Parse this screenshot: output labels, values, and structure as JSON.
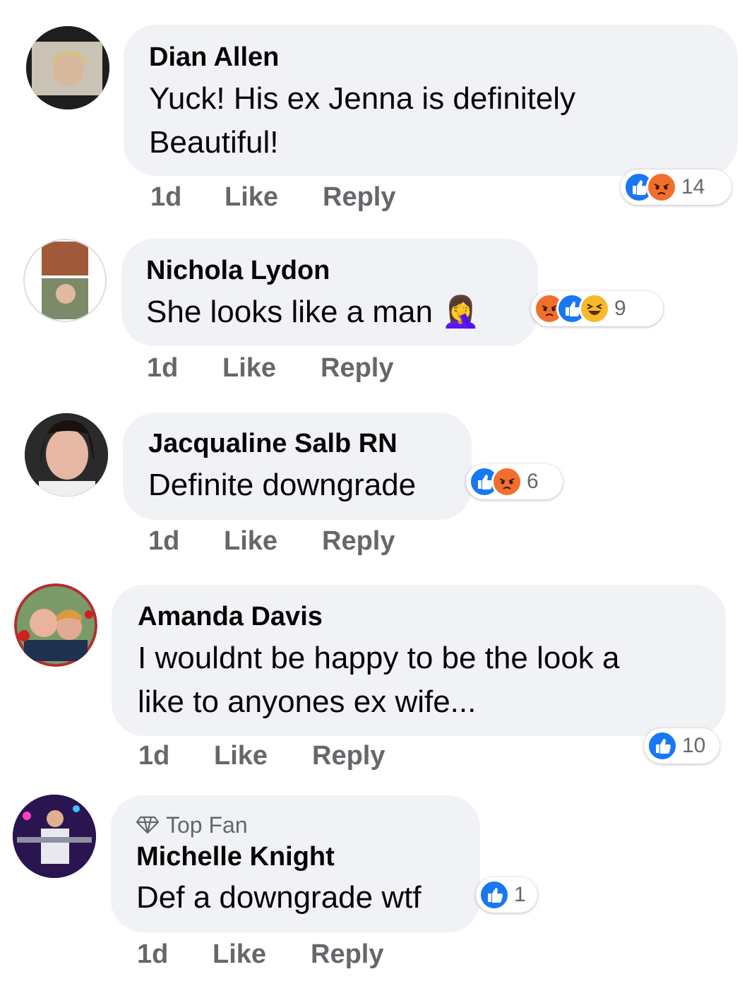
{
  "comments": [
    {
      "author": "Dian Allen",
      "text_lines": [
        "Yuck! His ex Jenna is definitely",
        "Beautiful!"
      ],
      "time": "1d",
      "like": "Like",
      "reply": "Reply",
      "reactions": [
        "like",
        "angry"
      ],
      "reaction_count": "14"
    },
    {
      "author": "Nichola Lydon",
      "text_lines": [
        "She looks like a man 🤦‍♀️"
      ],
      "time": "1d",
      "like": "Like",
      "reply": "Reply",
      "reactions": [
        "angry",
        "like",
        "haha"
      ],
      "reaction_count": "9"
    },
    {
      "author": "Jacqualine Salb RN",
      "text_lines": [
        "Definite downgrade"
      ],
      "time": "1d",
      "like": "Like",
      "reply": "Reply",
      "reactions": [
        "like",
        "angry"
      ],
      "reaction_count": "6"
    },
    {
      "author": "Amanda Davis",
      "text_lines": [
        "I wouldnt be happy to be the look a",
        "like to anyones ex wife..."
      ],
      "time": "1d",
      "like": "Like",
      "reply": "Reply",
      "reactions": [
        "like"
      ],
      "reaction_count": "10"
    },
    {
      "badge": "Top Fan",
      "author": "Michelle Knight",
      "text_lines": [
        "Def a downgrade wtf"
      ],
      "time": "1d",
      "like": "Like",
      "reply": "Reply",
      "reactions": [
        "like"
      ],
      "reaction_count": "1"
    }
  ],
  "colors": {
    "bubble": "#f0f2f5",
    "meta": "#65676b",
    "like": "#1877f2",
    "angry": "#f26e2c",
    "haha": "#f7b928"
  },
  "icons": {
    "like": "thumbs-up-icon",
    "angry": "angry-face-icon",
    "haha": "laughing-face-icon",
    "badge": "diamond-icon"
  }
}
